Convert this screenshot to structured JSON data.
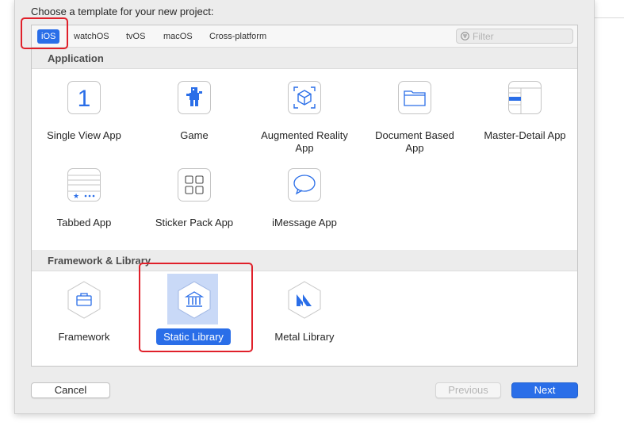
{
  "dialog": {
    "prompt": "Choose a template for your new project:"
  },
  "platform_tabs": [
    {
      "label": "iOS",
      "selected": true
    },
    {
      "label": "watchOS"
    },
    {
      "label": "tvOS"
    },
    {
      "label": "macOS"
    },
    {
      "label": "Cross-platform"
    }
  ],
  "filter": {
    "placeholder": "Filter",
    "icon": "filter-icon"
  },
  "sections": {
    "application": {
      "title": "Application",
      "templates": [
        {
          "label": "Single View App",
          "icon": "single-view-app-icon"
        },
        {
          "label": "Game",
          "icon": "game-icon"
        },
        {
          "label": "Augmented Reality App",
          "icon": "augmented-reality-icon"
        },
        {
          "label": "Document Based App",
          "icon": "document-based-app-icon"
        },
        {
          "label": "Master-Detail App",
          "icon": "master-detail-app-icon"
        },
        {
          "label": "Tabbed App",
          "icon": "tabbed-app-icon"
        },
        {
          "label": "Sticker Pack App",
          "icon": "sticker-pack-icon"
        },
        {
          "label": "iMessage App",
          "icon": "imessage-icon"
        }
      ]
    },
    "framework": {
      "title": "Framework & Library",
      "templates": [
        {
          "label": "Framework",
          "icon": "framework-icon"
        },
        {
          "label": "Static Library",
          "icon": "static-library-icon",
          "selected": true
        },
        {
          "label": "Metal Library",
          "icon": "metal-library-icon"
        }
      ]
    }
  },
  "buttons": {
    "cancel": "Cancel",
    "previous": "Previous",
    "next": "Next"
  },
  "colors": {
    "accent": "#2a6ee8",
    "selection_bg": "#c9d9f7",
    "annotation": "#e0202a"
  }
}
